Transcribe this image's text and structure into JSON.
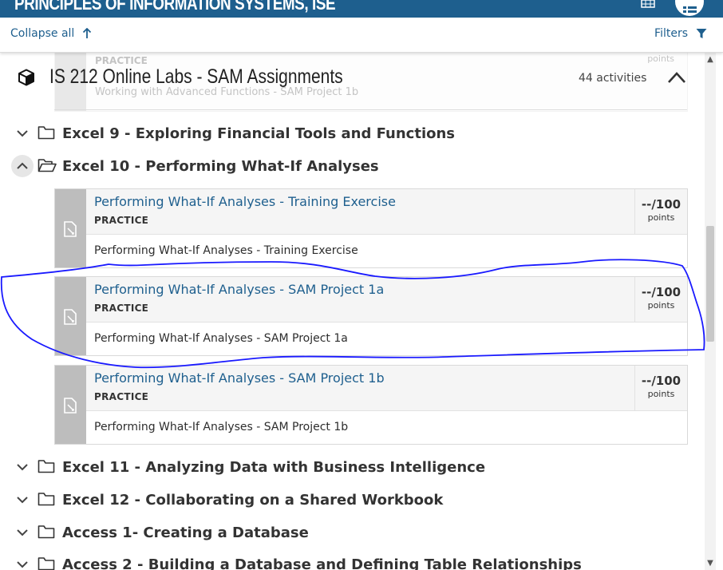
{
  "header": {
    "title": "PRINCIPLES OF INFORMATION SYSTEMS, ISE"
  },
  "toolbar": {
    "collapse_all": "Collapse all",
    "filters": "Filters"
  },
  "ghost_card": {
    "practice": "PRACTICE",
    "points_label": "points",
    "description": "Working with Advanced Functions - SAM Project 1b"
  },
  "course": {
    "title": "IS 212 Online Labs - SAM Assignments",
    "activity_count": "44 activities"
  },
  "sections": [
    {
      "title": "Excel 9 - Exploring Financial Tools and Functions",
      "expanded": false
    },
    {
      "title": "Excel 10 - Performing What-If Analyses",
      "expanded": true
    },
    {
      "title": "Excel 11 - Analyzing Data with Business Intelligence",
      "expanded": false
    },
    {
      "title": "Excel 12 - Collaborating on a Shared Workbook",
      "expanded": false
    },
    {
      "title": "Access 1- Creating a Database",
      "expanded": false
    },
    {
      "title": "Access 2 - Building a Database and Defining Table Relationships",
      "expanded": false
    }
  ],
  "activities": [
    {
      "title": "Performing What-If Analyses - Training Exercise",
      "type": "PRACTICE",
      "score": "--/100",
      "points_label": "points",
      "description": "Performing What-If Analyses - Training Exercise"
    },
    {
      "title": "Performing What-If Analyses - SAM Project 1a",
      "type": "PRACTICE",
      "score": "--/100",
      "points_label": "points",
      "description": "Performing What-If Analyses - SAM Project 1a"
    },
    {
      "title": "Performing What-If Analyses - SAM Project 1b",
      "type": "PRACTICE",
      "score": "--/100",
      "points_label": "points",
      "description": "Performing What-If Analyses - SAM Project 1b"
    }
  ],
  "colors": {
    "brand": "#1e5f8e",
    "annotation_ink": "#1a1aff",
    "card_side": "#bdbdbd"
  }
}
